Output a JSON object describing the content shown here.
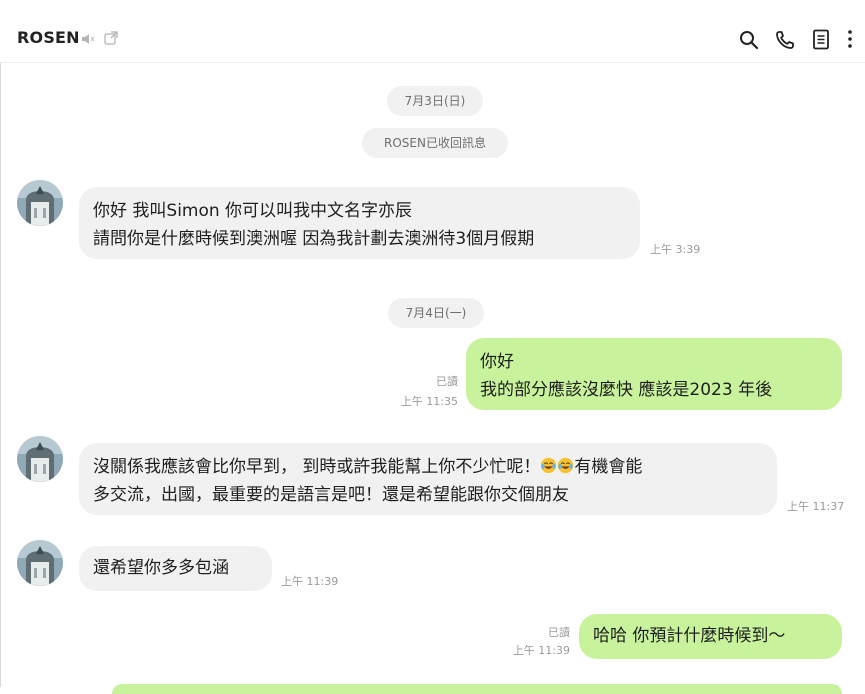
{
  "header": {
    "title": "ROSEN",
    "icons": [
      "speaker-muted-icon",
      "popout-icon",
      "search-icon",
      "phone-icon",
      "notes-icon",
      "more-icon"
    ]
  },
  "dates": {
    "first": "7月3日(日)",
    "second": "7月4日(一)"
  },
  "system": {
    "recall": "ROSEN已收回訊息"
  },
  "messages": [
    {
      "direction": "incoming",
      "lines": [
        "你好 我叫Simon 你可以叫我中文名字亦辰",
        "請問你是什麼時候到澳洲喔 因為我計劃去澳洲待3個月假期"
      ],
      "time": "上午 3:39"
    },
    {
      "direction": "outgoing",
      "lines": [
        "你好",
        "我的部分應該沒麼快 應該是2023 年後"
      ],
      "read": "已讀",
      "time": "上午 11:35"
    },
    {
      "direction": "incoming",
      "line1_before_emoji": "沒關係我應該會比你早到， 到時或許我能幫上你不少忙呢！",
      "line1_after_emoji": "有機會能",
      "line2": "多交流，出國，最重要的是語言是吧！還是希望能跟你交個朋友",
      "time": "上午 11:37"
    },
    {
      "direction": "incoming",
      "lines": [
        "還希望你多多包涵"
      ],
      "time": "上午 11:39"
    },
    {
      "direction": "outgoing",
      "lines": [
        "哈哈 你預計什麼時候到～"
      ],
      "read": "已讀",
      "time": "上午 11:39"
    }
  ],
  "colors": {
    "incoming_bubble": "#f1f1f2",
    "outgoing_bubble": "#c8f39c",
    "pill": "#f1f1f1"
  }
}
